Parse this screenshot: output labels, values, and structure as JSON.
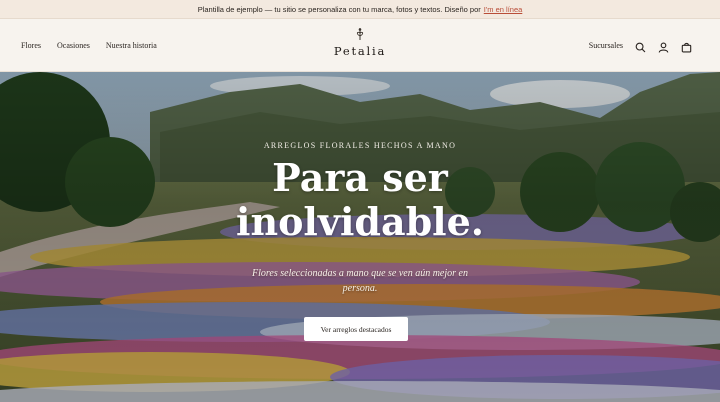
{
  "announcement": {
    "text": "Plantilla de ejemplo — tu sitio se personaliza con tu marca, fotos y textos. Diseño por",
    "link_text": "I'm en línea"
  },
  "header": {
    "nav_left": [
      "Flores",
      "Ocasiones",
      "Nuestra historia"
    ],
    "brand": "Petalia",
    "stores_label": "Sucursales",
    "icons": [
      "search-icon",
      "account-icon",
      "cart-icon"
    ]
  },
  "hero": {
    "eyebrow": "ARREGLOS FLORALES HECHOS A MANO",
    "headline_line1": "Para ser",
    "headline_line2": "inolvidable.",
    "subtitle": "Flores seleccionadas a mano que se ven aún mejor en persona.",
    "cta_label": "Ver arreglos destacados"
  },
  "colors": {
    "announcement_bg": "#f3e9df",
    "header_bg": "#f7f3ee",
    "link_accent": "#b94d38",
    "cta_bg": "#ffffff"
  }
}
